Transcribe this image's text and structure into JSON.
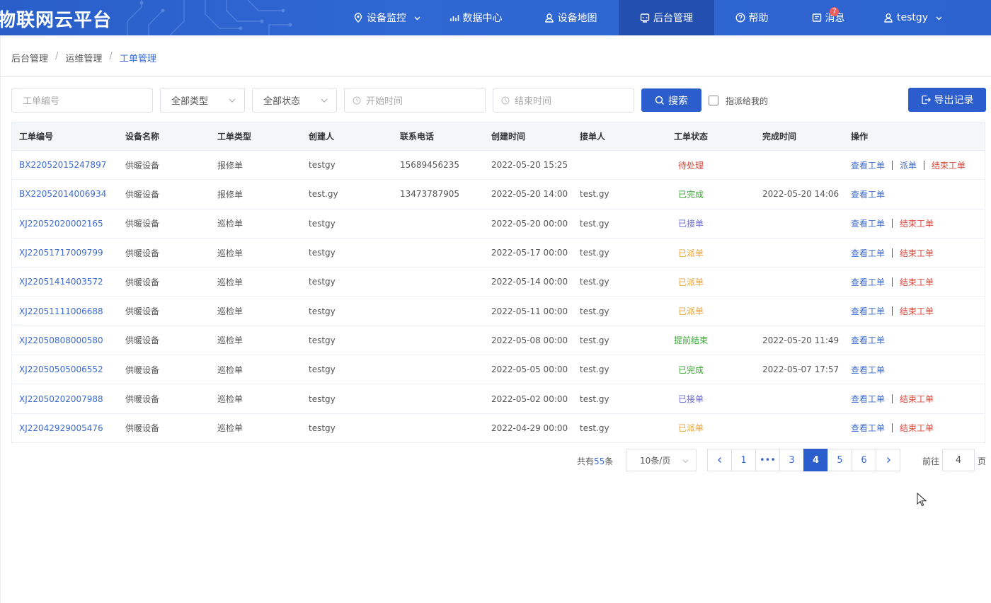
{
  "header": {
    "logo": "物联网云平台",
    "nav": [
      {
        "label": "设备监控",
        "icon": "location-pin-icon"
      },
      {
        "label": "数据中心",
        "icon": "chart-icon"
      },
      {
        "label": "设备地图",
        "icon": "map-person-icon"
      },
      {
        "label": "后台管理",
        "icon": "admin-icon"
      },
      {
        "label": "帮助",
        "icon": "help-icon"
      },
      {
        "label": "消息",
        "icon": "message-icon",
        "badge": "7"
      },
      {
        "label": "testgy",
        "icon": "user-icon"
      }
    ]
  },
  "breadcrumb": [
    "后台管理",
    "运维管理",
    "工单管理"
  ],
  "filters": {
    "order_no_placeholder": "工单编号",
    "type_value": "全部类型",
    "status_value": "全部状态",
    "start_placeholder": "开始时间",
    "end_placeholder": "结束时间",
    "search_label": "搜索",
    "assigned_label": "指派给我的",
    "export_label": "导出记录"
  },
  "table": {
    "columns": [
      "工单编号",
      "设备名称",
      "工单类型",
      "创建人",
      "联系电话",
      "创建时间",
      "接单人",
      "工单状态",
      "完成时间",
      "操作"
    ],
    "rows": [
      {
        "no": "BX22052015247897",
        "device": "供暖设备",
        "type": "报修单",
        "creator": "testgy",
        "phone": "15689456235",
        "created": "2022-05-20 15:25",
        "receiver": "",
        "status": "待处理",
        "status_color": "#d9483b",
        "finished": "",
        "ops": [
          "查看工单",
          "派单",
          "结束工单"
        ]
      },
      {
        "no": "BX22052014006934",
        "device": "供暖设备",
        "type": "报修单",
        "creator": "test.gy",
        "phone": "13473787905",
        "created": "2022-05-20 14:00",
        "receiver": "test.gy",
        "status": "已完成",
        "status_color": "#3aa832",
        "finished": "2022-05-20 14:06",
        "ops": [
          "查看工单"
        ]
      },
      {
        "no": "XJ22052020002165",
        "device": "供暖设备",
        "type": "巡检单",
        "creator": "testgy",
        "phone": "",
        "created": "2022-05-20 00:00",
        "receiver": "test.gy",
        "status": "已接单",
        "status_color": "#6a6cd0",
        "finished": "",
        "ops": [
          "查看工单",
          "结束工单"
        ]
      },
      {
        "no": "XJ22051717009799",
        "device": "供暖设备",
        "type": "巡检单",
        "creator": "testgy",
        "phone": "",
        "created": "2022-05-17 00:00",
        "receiver": "test.gy",
        "status": "已派单",
        "status_color": "#e8a33a",
        "finished": "",
        "ops": [
          "查看工单",
          "结束工单"
        ]
      },
      {
        "no": "XJ22051414003572",
        "device": "供暖设备",
        "type": "巡检单",
        "creator": "testgy",
        "phone": "",
        "created": "2022-05-14 00:00",
        "receiver": "test.gy",
        "status": "已派单",
        "status_color": "#e8a33a",
        "finished": "",
        "ops": [
          "查看工单",
          "结束工单"
        ]
      },
      {
        "no": "XJ22051111006688",
        "device": "供暖设备",
        "type": "巡检单",
        "creator": "testgy",
        "phone": "",
        "created": "2022-05-11 00:00",
        "receiver": "test.gy",
        "status": "已派单",
        "status_color": "#e8a33a",
        "finished": "",
        "ops": [
          "查看工单",
          "结束工单"
        ]
      },
      {
        "no": "XJ22050808000580",
        "device": "供暖设备",
        "type": "巡检单",
        "creator": "testgy",
        "phone": "",
        "created": "2022-05-08 00:00",
        "receiver": "test.gy",
        "status": "提前结束",
        "status_color": "#3aa832",
        "finished": "2022-05-20 11:49",
        "ops": [
          "查看工单"
        ]
      },
      {
        "no": "XJ22050505006552",
        "device": "供暖设备",
        "type": "巡检单",
        "creator": "testgy",
        "phone": "",
        "created": "2022-05-05 00:00",
        "receiver": "test.gy",
        "status": "已完成",
        "status_color": "#3aa832",
        "finished": "2022-05-07 17:57",
        "ops": [
          "查看工单"
        ]
      },
      {
        "no": "XJ22050202007988",
        "device": "供暖设备",
        "type": "巡检单",
        "creator": "testgy",
        "phone": "",
        "created": "2022-05-02 00:00",
        "receiver": "test.gy",
        "status": "已接单",
        "status_color": "#6a6cd0",
        "finished": "",
        "ops": [
          "查看工单",
          "结束工单"
        ]
      },
      {
        "no": "XJ22042929005476",
        "device": "供暖设备",
        "type": "巡检单",
        "creator": "testgy",
        "phone": "",
        "created": "2022-04-29 00:00",
        "receiver": "test.gy",
        "status": "已派单",
        "status_color": "#e8a33a",
        "finished": "",
        "ops": [
          "查看工单",
          "结束工单"
        ]
      }
    ]
  },
  "pagination": {
    "total_prefix": "共有",
    "total": "55",
    "total_suffix": "条",
    "page_size": "10条/页",
    "pages": [
      "1",
      "•••",
      "3",
      "4",
      "5",
      "6"
    ],
    "current": "4",
    "goto_label": "前往",
    "goto_value": "4",
    "page_unit": "页"
  },
  "colors": {
    "primary": "#2c5dcc",
    "link": "#3d6bd0",
    "danger": "#d9483b"
  }
}
